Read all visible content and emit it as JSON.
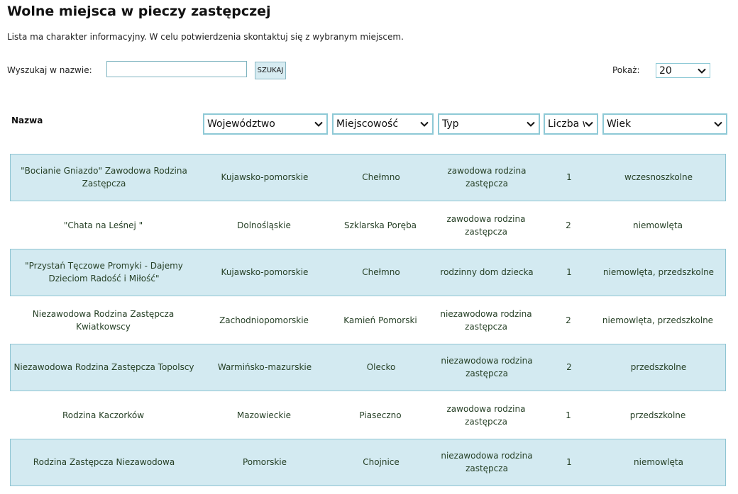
{
  "page": {
    "title": "Wolne miejsca w pieczy zastępczej",
    "info": "Lista ma charakter informacyjny. W celu potwierdzenia skontaktuj się z wybranym miejscem."
  },
  "search": {
    "label": "Wyszukaj w nazwie:",
    "value": "",
    "placeholder": "",
    "button_label": "SZUKAJ"
  },
  "show": {
    "label": "Pokaż:",
    "selected": "20"
  },
  "columns": {
    "name_header": "Nazwa",
    "wojewodztwo": "Województwo",
    "miejscowosc": "Miejscowość",
    "typ": "Typ",
    "liczba": "Liczba w",
    "wiek": "Wiek"
  },
  "rows": [
    {
      "name": "\"Bocianie Gniazdo\" Zawodowa Rodzina Zastępcza",
      "wojewodztwo": "Kujawsko-pomorskie",
      "miejscowosc": "Chełmno",
      "typ": "zawodowa rodzina zastępcza",
      "liczba": "1",
      "wiek": "wczesnoszkolne"
    },
    {
      "name": "\"Chata na Leśnej \"",
      "wojewodztwo": "Dolnośląskie",
      "miejscowosc": "Szklarska Poręba",
      "typ": "zawodowa rodzina zastępcza",
      "liczba": "2",
      "wiek": "niemowlęta"
    },
    {
      "name": "\"Przystań Tęczowe Promyki - Dajemy Dzieciom Radość i Miłość\"",
      "wojewodztwo": "Kujawsko-pomorskie",
      "miejscowosc": "Chełmno",
      "typ": "rodzinny dom dziecka",
      "liczba": "1",
      "wiek": "niemowlęta, przedszkolne"
    },
    {
      "name": "Niezawodowa Rodzina Zastępcza Kwiatkowscy",
      "wojewodztwo": "Zachodniopomorskie",
      "miejscowosc": "Kamień Pomorski",
      "typ": "niezawodowa rodzina zastępcza",
      "liczba": "2",
      "wiek": "niemowlęta, przedszkolne"
    },
    {
      "name": "Niezawodowa Rodzina Zastępcza Topolscy",
      "wojewodztwo": "Warmińsko-mazurskie",
      "miejscowosc": "Olecko",
      "typ": "niezawodowa rodzina zastępcza",
      "liczba": "2",
      "wiek": "przedszkolne"
    },
    {
      "name": "Rodzina Kaczorków",
      "wojewodztwo": "Mazowieckie",
      "miejscowosc": "Piaseczno",
      "typ": "zawodowa rodzina zastępcza",
      "liczba": "1",
      "wiek": "przedszkolne"
    },
    {
      "name": "Rodzina Zastępcza Niezawodowa",
      "wojewodztwo": "Pomorskie",
      "miejscowosc": "Chojnice",
      "typ": "niezawodowa rodzina zastępcza",
      "liczba": "1",
      "wiek": "niemowlęta"
    }
  ],
  "colors": {
    "row_shade": "#d3eaf1",
    "row_border": "#8fc5d3",
    "select_border": "#8ec9d6",
    "cell_text": "#264026"
  }
}
